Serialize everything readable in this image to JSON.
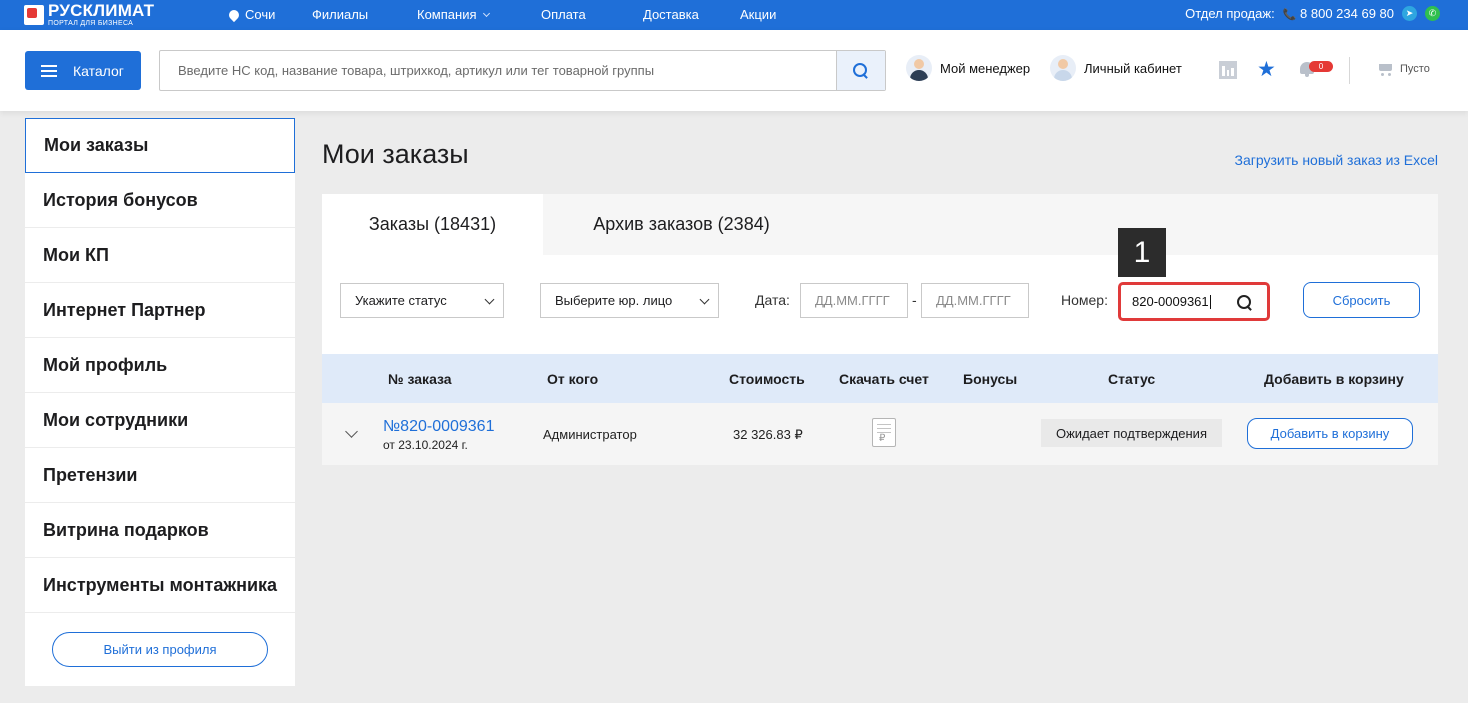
{
  "topbar": {
    "logo_name": "РУСКЛИМАТ",
    "logo_sub": "ПОРТАЛ ДЛЯ БИЗНЕСА",
    "city": "Сочи",
    "nav": [
      "Филиалы",
      "Компания",
      "Оплата",
      "Доставка",
      "Акции"
    ],
    "sales_label": "Отдел продаж:",
    "phone": "8 800 234 69 80",
    "accent_color": "#1f6fd8"
  },
  "header": {
    "catalog_label": "Каталог",
    "search_placeholder": "Введите НС код, название товара, штрихкод, артикул или тег товарной группы",
    "manager_label": "Мой менеджер",
    "cabinet_label": "Личный кабинет",
    "notifications_count": "0",
    "cart_label": "Пусто"
  },
  "sidebar": {
    "items": [
      "Мои заказы",
      "История бонусов",
      "Мои КП",
      "Интернет Партнер",
      "Мой профиль",
      "Мои сотрудники",
      "Претензии",
      "Витрина подарков",
      "Инструменты монтажника"
    ],
    "logout_label": "Выйти из профиля"
  },
  "main": {
    "title": "Мои заказы",
    "upload_link": "Загрузить новый заказ из Excel",
    "tabs": [
      "Заказы (18431)",
      "Архив заказов (2384)"
    ],
    "filters": {
      "status_placeholder": "Укажите статус",
      "entity_placeholder": "Выберите юр. лицо",
      "date_label": "Дата:",
      "date_from": "ДД.ММ.ГГГГ",
      "date_sep": "-",
      "date_to": "ДД.ММ.ГГГГ",
      "number_label": "Номер:",
      "number_value": "820-0009361",
      "callout": "1",
      "reset_label": "Сбросить"
    },
    "table": {
      "headers": [
        "№ заказа",
        "От кого",
        "Стоимость",
        "Скачать счет",
        "Бонусы",
        "Статус",
        "Добавить в корзину"
      ],
      "rows": [
        {
          "number": "№820-0009361",
          "date": "от 23.10.2024 г.",
          "from": "Администратор",
          "cost": "32 326.83 ₽",
          "status": "Ожидает подтверждения",
          "add_label": "Добавить в корзину"
        }
      ]
    }
  }
}
